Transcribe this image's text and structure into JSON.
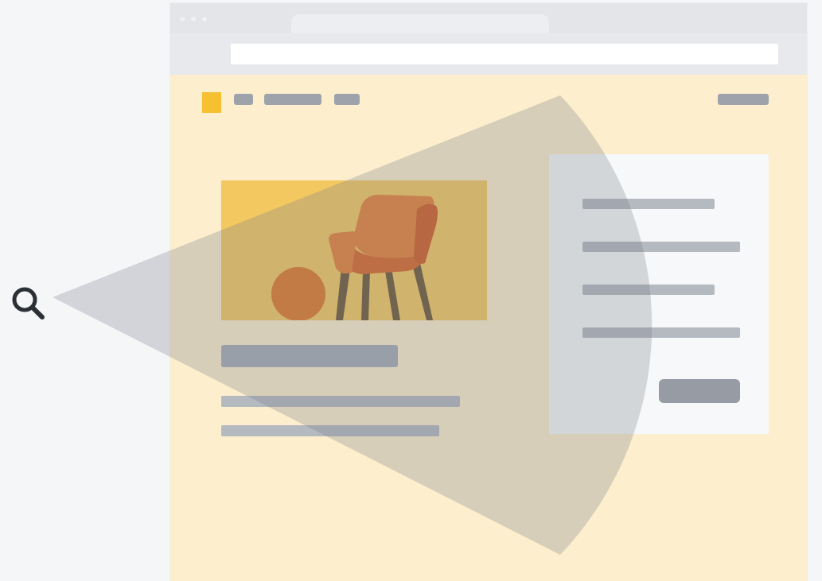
{
  "colors": {
    "page_background": "#f5f6f8",
    "browser_chrome": "#e3e5e8",
    "address_bar": "#ffffff",
    "site_background": "#fdeecd",
    "brand_yellow": "#f6c031",
    "hero_background": "#f3c861",
    "chair_orange": "#e07a2c",
    "placeholder_gray": "#a7acb4",
    "form_panel": "#f7f8f9",
    "button_gray": "#979ca4",
    "search_beam": "rgba(120,125,135,0.28)",
    "icon_dark": "#2b2f36"
  },
  "icons": {
    "search": "magnifying-glass",
    "hero_image": "armchair-and-ball-illustration",
    "site_logo": "yellow-square-logo"
  }
}
